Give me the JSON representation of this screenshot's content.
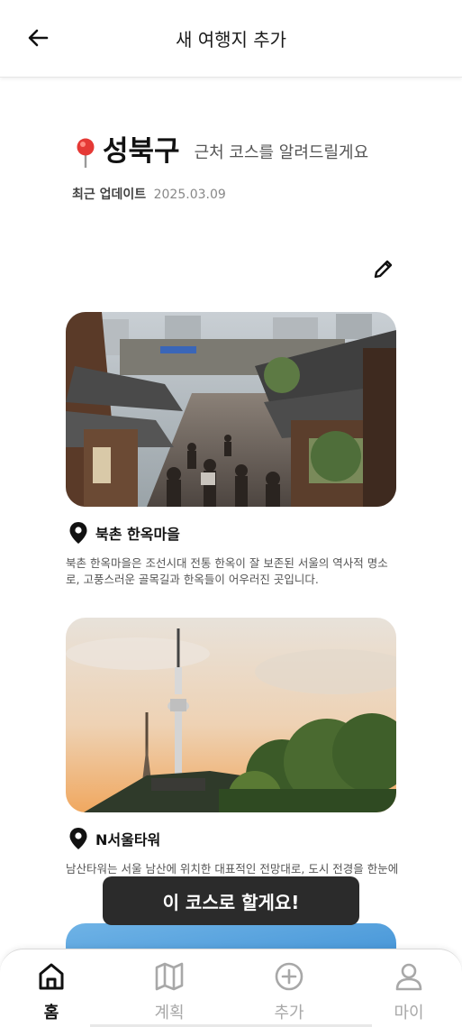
{
  "header": {
    "title": "새 여행지 추가"
  },
  "region": {
    "name": "성북구",
    "subtitle": "근처 코스를 알려드릴게요"
  },
  "updated": {
    "label": "최근 업데이트",
    "date": "2025.03.09"
  },
  "places": [
    {
      "name": "북촌 한옥마을",
      "description": "북촌 한옥마을은 조선시대 전통 한옥이 잘 보존된 서울의 역사적 명소로, 고풍스러운 골목길과 한옥들이 어우러진 곳입니다."
    },
    {
      "name": "N서울타워",
      "description": "남산타워는 서울 남산에 위치한 대표적인 전망대로, 도시 전경을 한눈에"
    }
  ],
  "cta": {
    "label": "이 코스로 할게요!"
  },
  "tabs": [
    {
      "label": "홈",
      "icon": "home-icon"
    },
    {
      "label": "계획",
      "icon": "map-icon"
    },
    {
      "label": "추가",
      "icon": "plus-circle-icon"
    },
    {
      "label": "마이",
      "icon": "user-icon"
    }
  ],
  "colors": {
    "cta_bg": "#2b2b2b",
    "active_tab": "#111111",
    "inactive_tab": "#a8a8a8"
  }
}
